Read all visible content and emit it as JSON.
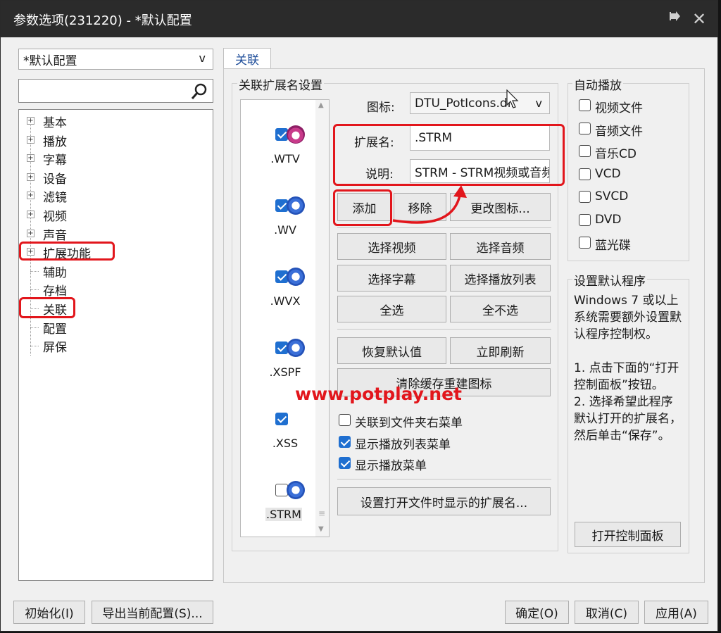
{
  "window": {
    "title": "参数选项(231220) - *默认配置",
    "pin_icon": "pin-icon",
    "close_icon": "close-icon"
  },
  "left": {
    "profile_select": "*默认配置",
    "profile_arrow": "v",
    "search_placeholder": "",
    "tree": [
      {
        "label": "基本",
        "expandable": true
      },
      {
        "label": "播放",
        "expandable": true
      },
      {
        "label": "字幕",
        "expandable": true
      },
      {
        "label": "设备",
        "expandable": true
      },
      {
        "label": "滤镜",
        "expandable": true
      },
      {
        "label": "视频",
        "expandable": true
      },
      {
        "label": "声音",
        "expandable": true
      },
      {
        "label": "扩展功能",
        "expandable": true
      },
      {
        "label": "辅助",
        "expandable": false
      },
      {
        "label": "存档",
        "expandable": false
      },
      {
        "label": "关联",
        "expandable": false,
        "selected": true
      },
      {
        "label": "配置",
        "expandable": false
      },
      {
        "label": "屏保",
        "expandable": false
      }
    ]
  },
  "tab": {
    "label": "关联"
  },
  "assoc": {
    "group_title": "关联扩展名设置",
    "extensions": [
      {
        "name": ".WTV",
        "checked": true
      },
      {
        "name": ".WV",
        "checked": true
      },
      {
        "name": ".WVX",
        "checked": true
      },
      {
        "name": ".XSPF",
        "checked": true
      },
      {
        "name": ".XSS",
        "checked": true
      },
      {
        "name": ".STRM",
        "checked": false
      }
    ],
    "icon_label": "图标:",
    "icon_value": "DTU_PotIcons.dll",
    "icon_arrow": "v",
    "ext_label": "扩展名:",
    "ext_value": ".STRM",
    "desc_label": "说明:",
    "desc_value": "STRM - STRM视频或音频",
    "btn_add": "添加",
    "btn_remove": "移除",
    "btn_change_icon": "更改图标...",
    "btn_select_video": "选择视频",
    "btn_select_audio": "选择音频",
    "btn_select_subtitle": "选择字幕",
    "btn_select_playlist": "选择播放列表",
    "btn_select_all": "全选",
    "btn_select_none": "全不选",
    "btn_restore": "恢复默认值",
    "btn_refresh": "立即刷新",
    "btn_clear_cache": "清除缓存重建图标",
    "watermark": "www.potplay.net",
    "opt_folder_menu": "关联到文件夹右菜单",
    "opt_folder_menu_checked": false,
    "opt_playlist_menu": "显示播放列表菜单",
    "opt_playlist_menu_checked": true,
    "opt_play_menu": "显示播放菜单",
    "opt_play_menu_checked": true,
    "btn_set_open_ext": "设置打开文件时显示的扩展名..."
  },
  "autoplay": {
    "title": "自动播放",
    "items": [
      {
        "label": "视频文件",
        "checked": false
      },
      {
        "label": "音频文件",
        "checked": false
      },
      {
        "label": "音乐CD",
        "checked": false
      },
      {
        "label": "VCD",
        "checked": false
      },
      {
        "label": "SVCD",
        "checked": false
      },
      {
        "label": "DVD",
        "checked": false
      },
      {
        "label": "蓝光碟",
        "checked": false
      }
    ]
  },
  "default_program": {
    "title": "设置默认程序",
    "text1": "Windows 7 或以上系统需要额外设置默认程序控制权。",
    "text2": "1. 点击下面的“打开控制面板”按钮。",
    "text3": "2. 选择希望此程序默认打开的扩展名，然后单击“保存”。",
    "btn_open_panel": "打开控制面板"
  },
  "footer": {
    "btn_init": "初始化(I)",
    "btn_export": "导出当前配置(S)...",
    "btn_ok": "确定(O)",
    "btn_cancel": "取消(C)",
    "btn_apply": "应用(A)"
  },
  "colors": {
    "highlight": "#e2161c",
    "check": "#1f6fd0",
    "titlebar": "#2b2b2b"
  }
}
